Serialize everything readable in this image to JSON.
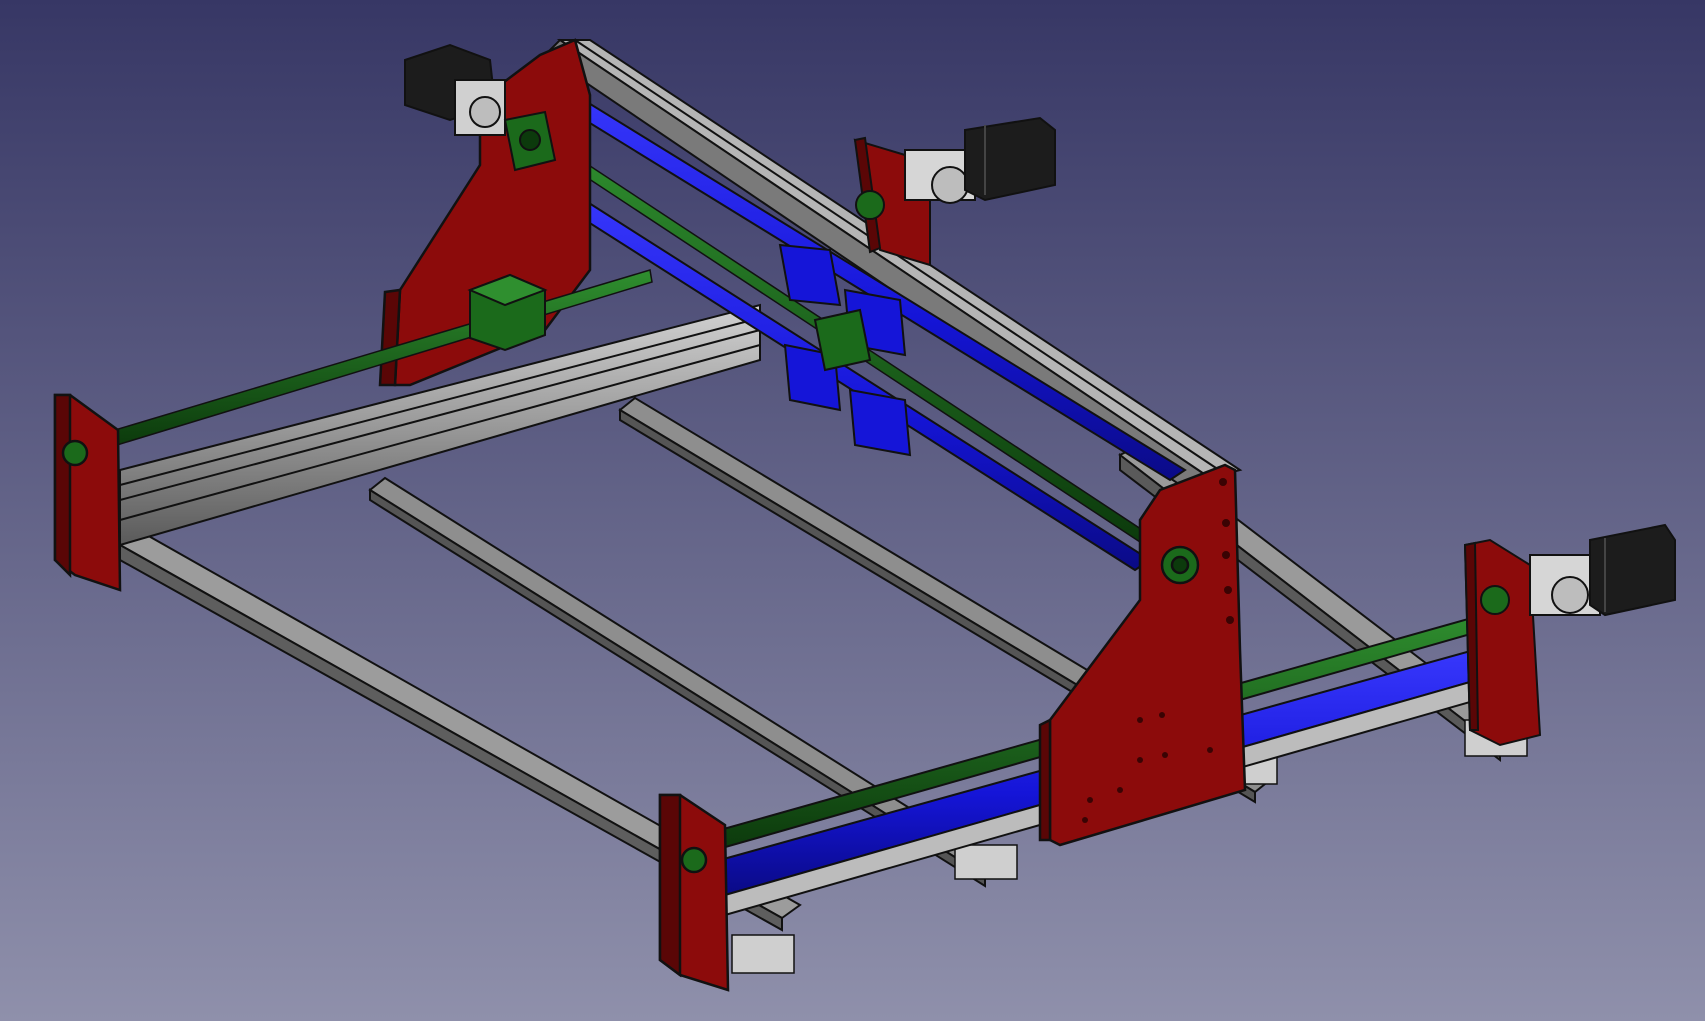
{
  "app": {
    "view": "3D viewport"
  },
  "colors": {
    "bg_top": "#373765",
    "bg_bottom": "#8f90ab",
    "plate_red": "#8c0b0b",
    "plate_red_edge": "#5a0606",
    "rod_blue": "#1515d8",
    "rod_blue_dark": "#0a0a86",
    "screw_green": "#1b6a1b",
    "screw_green_dark": "#0c3a0c",
    "extrusion_light": "#b8b8b8",
    "extrusion_mid": "#8e8e8e",
    "extrusion_dark": "#4a4a4a",
    "motor_black": "#1c1c1c",
    "motor_silver": "#c9c9c9",
    "outline": "#111111"
  },
  "model": {
    "parts": [
      {
        "name": "gantry-side-plate",
        "material": "red"
      },
      {
        "name": "end-plate",
        "material": "red"
      },
      {
        "name": "linear-rail-rod",
        "material": "blue"
      },
      {
        "name": "lead-screw",
        "material": "green"
      },
      {
        "name": "aluminium-extrusion",
        "material": "grey"
      },
      {
        "name": "stepper-motor",
        "material": "black"
      }
    ]
  }
}
